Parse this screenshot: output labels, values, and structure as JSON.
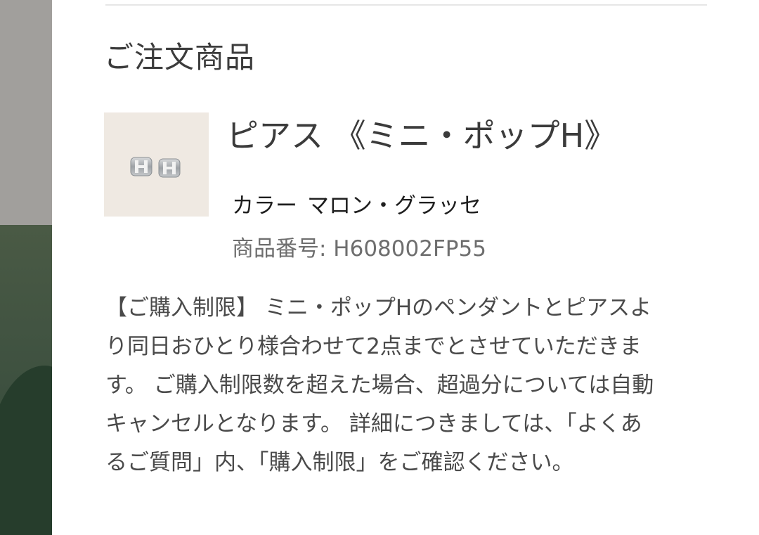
{
  "section": {
    "title": "ご注文商品"
  },
  "product": {
    "image_alt": "earrings-thumbnail",
    "name": "ピアス 《ミニ・ポップH》",
    "color_label": "カラー",
    "color_value": "マロン・グラッセ",
    "sku": "商品番号: H608002FP55"
  },
  "notice": {
    "text": "【ご購入制限】 ミニ・ポップHのペンダントとピアスより同日おひとり様合わせて2点までとさせていただきます。 ご購入制限数を超えた場合、超過分については自動キャンセルとなります。 詳細につきましては、「よくあるご質問」内、「購入制限」をご確認ください。"
  },
  "colors": {
    "thumb_bg": "#efe9e2",
    "left_panel_top": "#a19f9c",
    "left_panel_bottom": "#3e5140"
  }
}
